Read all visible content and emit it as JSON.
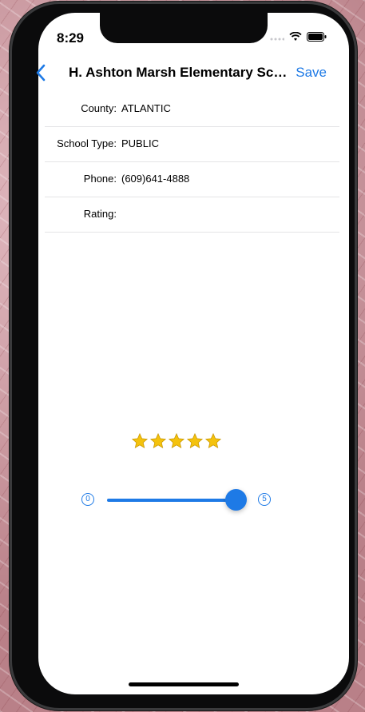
{
  "status_bar": {
    "time": "8:29"
  },
  "nav": {
    "title": "H. Ashton Marsh Elementary Sch...",
    "save_label": "Save",
    "back_icon": "chevron-left-icon"
  },
  "details": [
    {
      "label": "County:",
      "value": "ATLANTIC"
    },
    {
      "label": "School Type:",
      "value": "PUBLIC"
    },
    {
      "label": "Phone:",
      "value": "(609)641-4888"
    },
    {
      "label": "Rating:",
      "value": ""
    }
  ],
  "rating": {
    "stars": 5,
    "slider_min": "0",
    "slider_max": "5",
    "slider_value": 5
  },
  "colors": {
    "accent": "#1e7ae6",
    "star": "#f4c20d"
  }
}
